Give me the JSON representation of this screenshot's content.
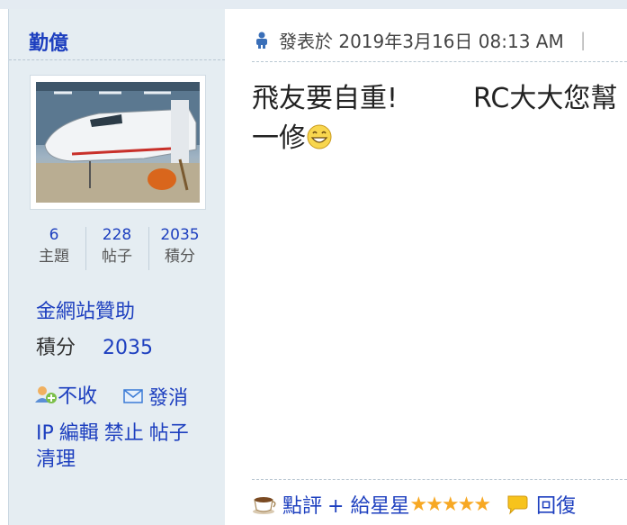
{
  "user": {
    "name": "勤億",
    "stats": [
      {
        "value": "6",
        "label": "主題"
      },
      {
        "value": "228",
        "label": "帖子"
      },
      {
        "value": "2035",
        "label": "積分"
      }
    ],
    "sponsor": "金網站贊助",
    "score_label": "積分",
    "score_value": "2035",
    "actions": [
      {
        "label": "不收",
        "icon": "add-friend-icon"
      },
      {
        "label": "發消",
        "icon": "envelope-icon"
      }
    ],
    "admin_links": [
      "IP",
      "編輯",
      "禁止",
      "帖子",
      "清理"
    ]
  },
  "post": {
    "posted_prefix": "發表於",
    "posted_time": "2019年3月16日 08:13 AM",
    "separator": "|",
    "content_line1": "飛友要自重!",
    "content_line1b": "RC大大您幫",
    "content_line2": "一修",
    "content_emoji": "grinning-face-icon",
    "footer": {
      "rate_label": "點評",
      "star_label": "+ 給星星",
      "stars": "★★★★★",
      "reply_label": "回復"
    }
  },
  "colors": {
    "link": "#1d3fbf",
    "sidebar_bg": "#e5edf2",
    "star": "#f7a823"
  }
}
